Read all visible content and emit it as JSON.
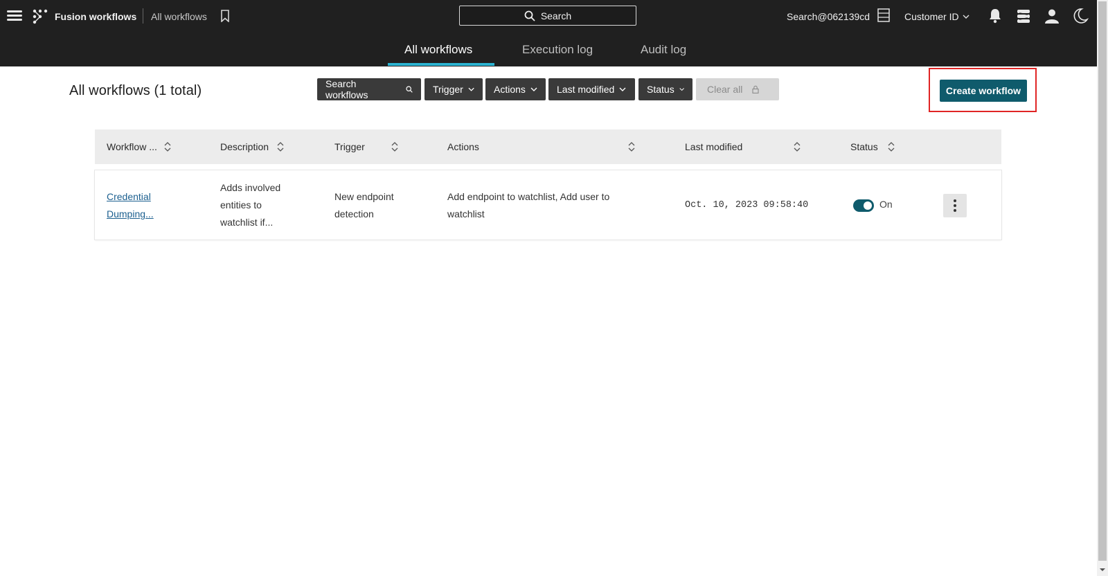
{
  "header": {
    "app_name": "Fusion workflows",
    "breadcrumb_page": "All workflows",
    "search_label": "Search",
    "user_account": "Search@062139cd",
    "customer_id": "Customer ID"
  },
  "tabs": [
    {
      "label": "All workflows",
      "active": true
    },
    {
      "label": "Execution log",
      "active": false
    },
    {
      "label": "Audit log",
      "active": false
    }
  ],
  "toolbar": {
    "title": "All workflows (1 total)",
    "filters": [
      "Search workflows",
      "Trigger",
      "Actions",
      "Last modified",
      "Status"
    ],
    "clear_all": "Clear all",
    "create_label": "Create workflow"
  },
  "table": {
    "columns": [
      "Workflow ...",
      "Description",
      "Trigger",
      "Actions",
      "Last modified",
      "Status"
    ],
    "rows": [
      {
        "name_line1": "Credential",
        "name_line2": "Dumping...",
        "description_line1": "Adds involved",
        "description_line2": "entities to",
        "description_line3": "watchlist if...",
        "trigger_line1": "New endpoint",
        "trigger_line2": "detection",
        "actions_line1": "Add endpoint to watchlist, Add user to",
        "actions_line2": "watchlist",
        "last_modified": "Oct. 10, 2023 09:58:40",
        "status": "On"
      }
    ]
  },
  "colors": {
    "topbar": "#202020",
    "accent_tab": "#2bb3d1",
    "primary_button": "#0f5b6c",
    "highlight": "#e02424"
  }
}
